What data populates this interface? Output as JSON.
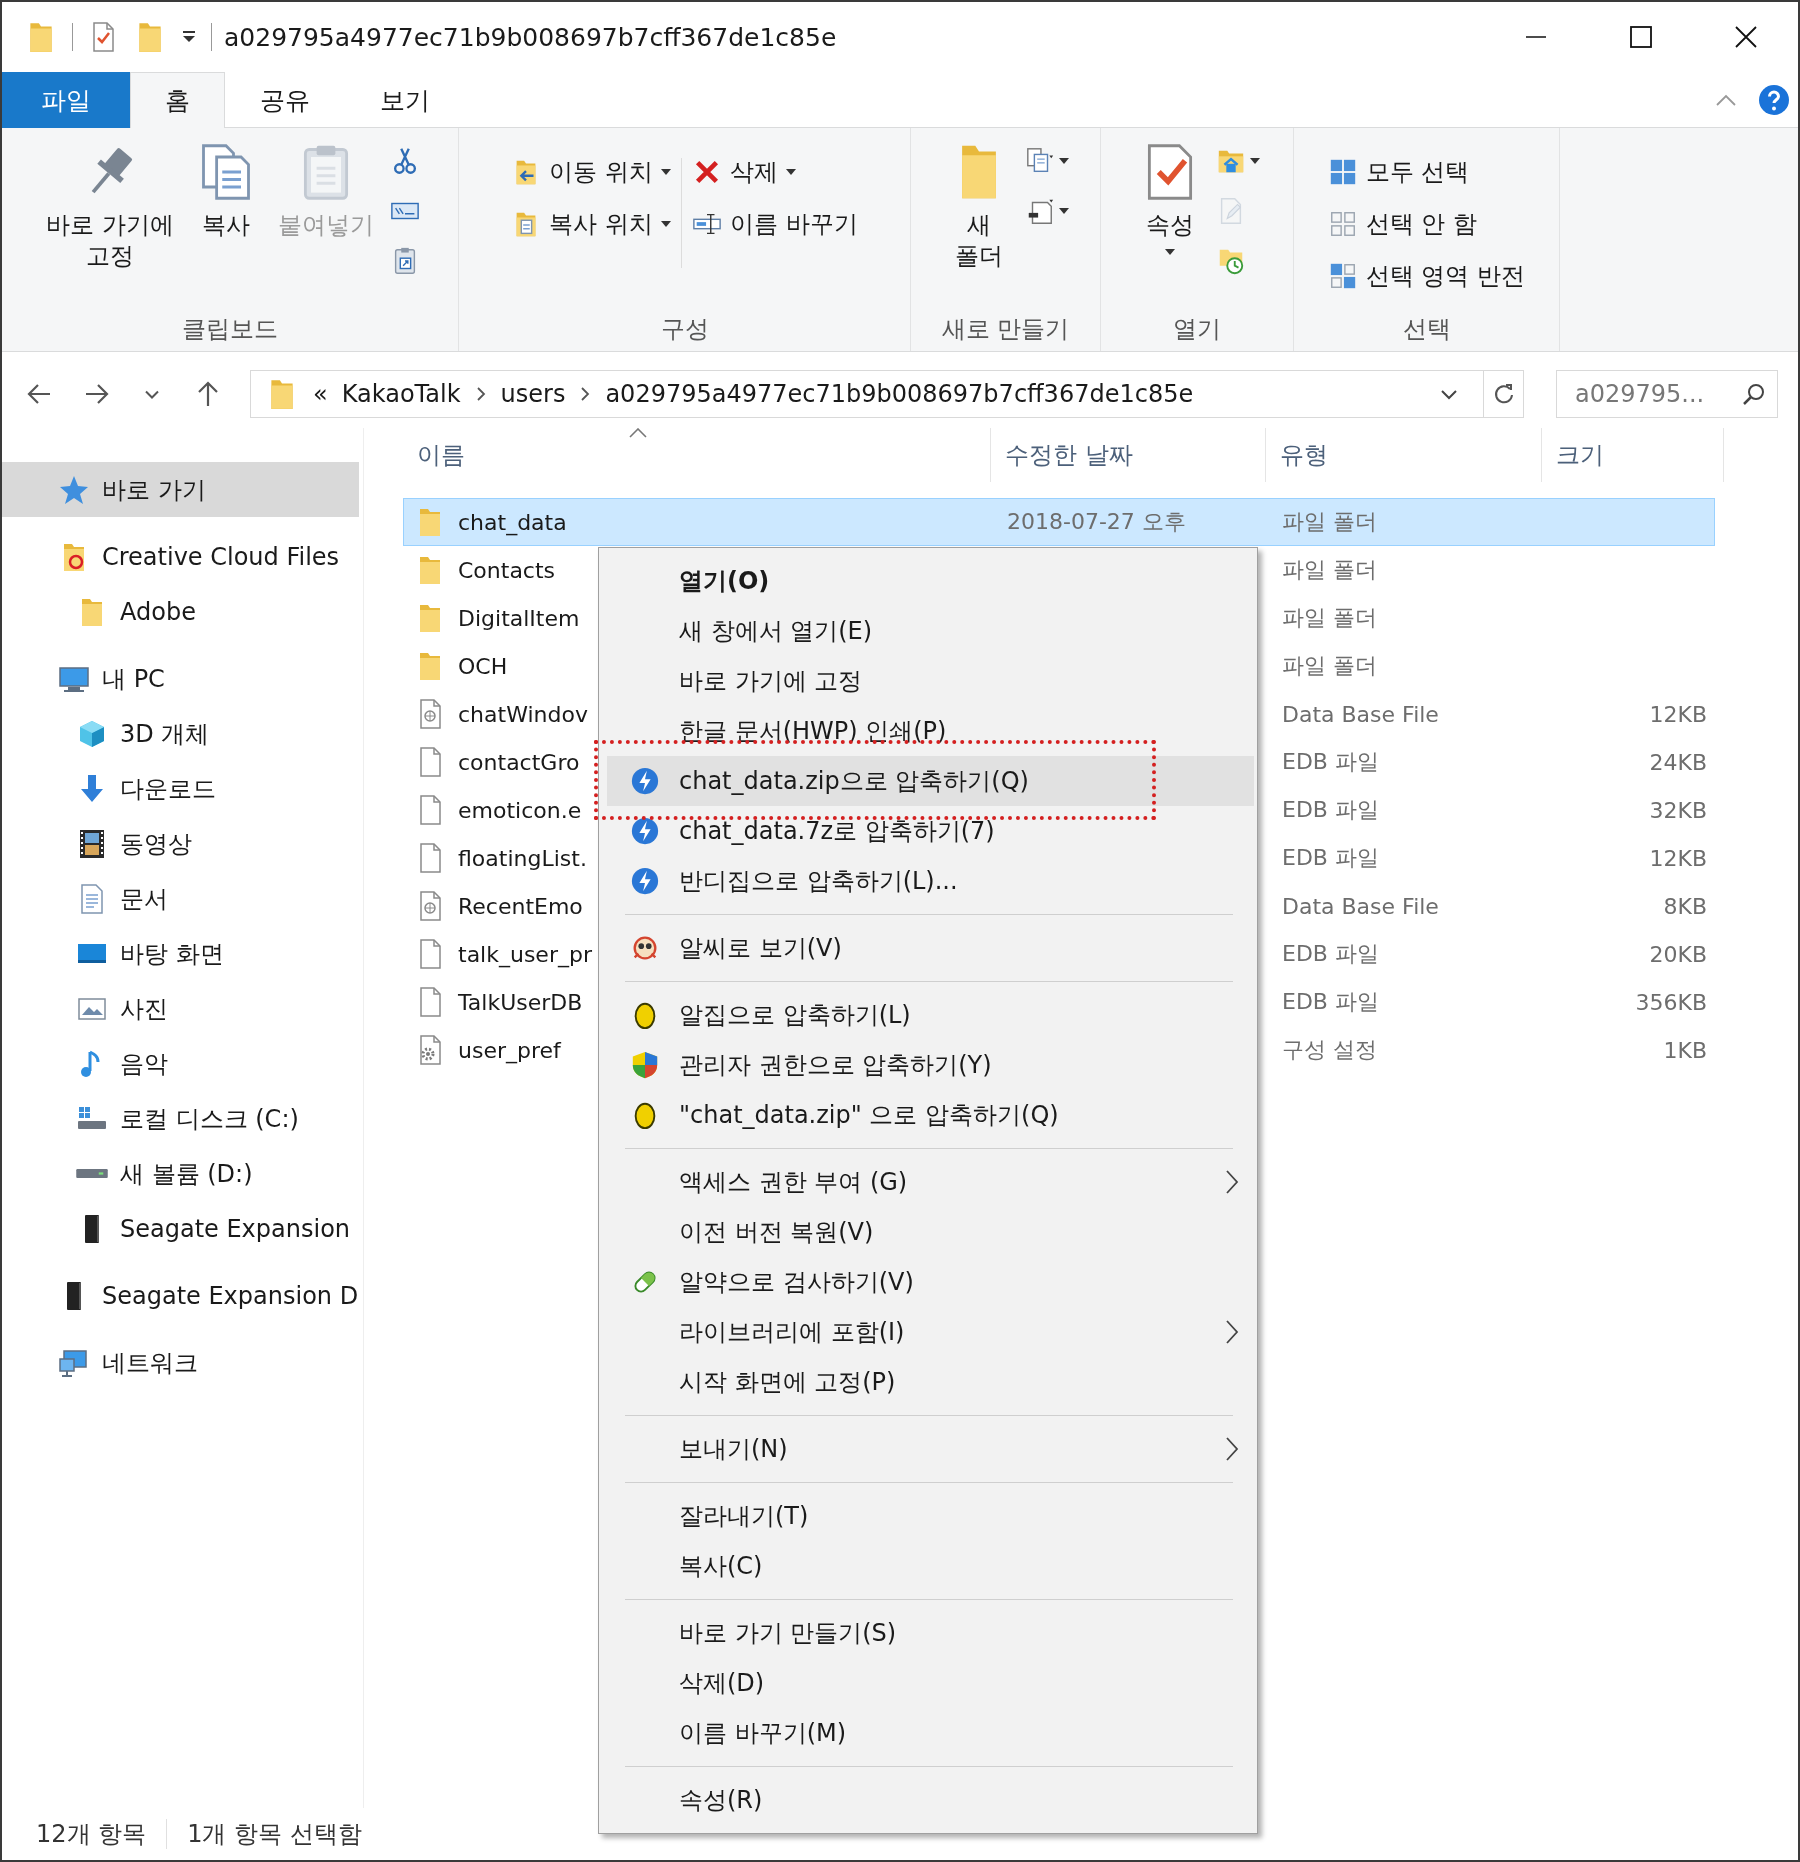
{
  "window": {
    "title": "a029795a4977ec71b9b008697b7cff367de1c85e"
  },
  "ribbon_tabs": [
    {
      "label": "파일",
      "kind": "file",
      "selected": false
    },
    {
      "label": "홈",
      "kind": "tab",
      "selected": true
    },
    {
      "label": "공유",
      "kind": "tab",
      "selected": false
    },
    {
      "label": "보기",
      "kind": "tab",
      "selected": false
    }
  ],
  "ribbon_groups": [
    {
      "label": "클립보드",
      "commands": [
        {
          "kind": "large",
          "label": "바로 가기에\n고정",
          "disabled": false,
          "dropdown": false
        },
        {
          "kind": "large",
          "label": "복사",
          "disabled": false,
          "dropdown": false
        },
        {
          "kind": "large",
          "label": "붙여넣기",
          "disabled": true,
          "dropdown": false
        },
        {
          "kind": "stack",
          "items": [
            {
              "disabled": false,
              "dropdown": false
            },
            {
              "disabled": false,
              "dropdown": false
            },
            {
              "disabled": false,
              "dropdown": false
            }
          ]
        }
      ]
    },
    {
      "label": "구성",
      "commands": [
        {
          "kind": "column",
          "items": [
            {
              "label": "이동 위치",
              "disabled": false,
              "dropdown": true
            },
            {
              "label": "복사 위치",
              "disabled": false,
              "dropdown": true
            }
          ]
        },
        {
          "kind": "column",
          "items": [
            {
              "label": "삭제",
              "disabled": false,
              "dropdown": true
            },
            {
              "label": "이름 바꾸기",
              "disabled": false,
              "dropdown": false
            }
          ]
        }
      ]
    },
    {
      "label": "새로 만들기",
      "commands": [
        {
          "kind": "large",
          "label": "새\n폴더",
          "disabled": false,
          "dropdown": false
        },
        {
          "kind": "stack",
          "items": [
            {
              "disabled": false,
              "dropdown": true
            },
            {
              "disabled": false,
              "dropdown": true
            }
          ]
        }
      ]
    },
    {
      "label": "열기",
      "commands": [
        {
          "kind": "large",
          "label": "속성",
          "disabled": false,
          "dropdown": true
        },
        {
          "kind": "stack",
          "items": [
            {
              "disabled": false,
              "dropdown": true
            },
            {
              "disabled": true,
              "dropdown": false
            },
            {
              "disabled": false,
              "dropdown": false
            }
          ]
        }
      ]
    },
    {
      "label": "선택",
      "commands": [
        {
          "kind": "column",
          "items": [
            {
              "label": "모두 선택",
              "disabled": false,
              "dropdown": false
            },
            {
              "label": "선택 안 함",
              "disabled": false,
              "dropdown": false
            },
            {
              "label": "선택 영역 반전",
              "disabled": false,
              "dropdown": false
            }
          ]
        }
      ]
    }
  ],
  "address_bar": {
    "overflow": "«",
    "breadcrumbs": [
      "KakaoTalk",
      "users",
      "a029795a4977ec71b9b008697b7cff367de1c85e"
    ]
  },
  "search": {
    "placeholder": "a029795..."
  },
  "sidebar": {
    "items": [
      {
        "label": "바로 가기",
        "selected": true
      },
      {
        "label": "Creative Cloud Files",
        "selected": false,
        "children": [
          {
            "label": "Adobe",
            "selected": false
          }
        ]
      },
      {
        "label": "내 PC",
        "selected": false,
        "children": [
          {
            "label": "3D 개체",
            "selected": false
          },
          {
            "label": "다운로드",
            "selected": false
          },
          {
            "label": "동영상",
            "selected": false
          },
          {
            "label": "문서",
            "selected": false
          },
          {
            "label": "바탕 화면",
            "selected": false
          },
          {
            "label": "사진",
            "selected": false
          },
          {
            "label": "음악",
            "selected": false
          },
          {
            "label": "로컬 디스크 (C:)",
            "selected": false
          },
          {
            "label": "새 볼륨 (D:)",
            "selected": false
          },
          {
            "label": "Seagate Expansion",
            "selected": false
          }
        ]
      },
      {
        "label": "Seagate Expansion D",
        "selected": false
      },
      {
        "label": "네트워크",
        "selected": false
      }
    ]
  },
  "table": {
    "columns": [
      "이름",
      "수정한 날짜",
      "유형",
      "크기"
    ],
    "rows": [
      {
        "kind": "folder",
        "name": "chat_data",
        "date": "2018-07-27 오후",
        "type": "파일 폴더",
        "size": "",
        "selected": true
      },
      {
        "kind": "folder",
        "name": "Contacts",
        "type": "파일 폴더",
        "size": "",
        "selected": false
      },
      {
        "kind": "folder",
        "name": "DigitalItem",
        "type": "파일 폴더",
        "size": "",
        "selected": false
      },
      {
        "kind": "folder",
        "name": "OCH",
        "type": "파일 폴더",
        "size": "",
        "selected": false
      },
      {
        "kind": "database",
        "name": "chatWindov",
        "type": "Data Base File",
        "size": "12KB",
        "selected": false
      },
      {
        "kind": "file",
        "name": "contactGro",
        "type": "EDB 파일",
        "size": "24KB",
        "selected": false
      },
      {
        "kind": "file",
        "name": "emoticon.e",
        "type": "EDB 파일",
        "size": "32KB",
        "selected": false
      },
      {
        "kind": "file",
        "name": "floatingList.",
        "type": "EDB 파일",
        "size": "12KB",
        "selected": false
      },
      {
        "kind": "database",
        "name": "RecentEmo",
        "type": "Data Base File",
        "size": "8KB",
        "selected": false
      },
      {
        "kind": "file",
        "name": "talk_user_pr",
        "type": "EDB 파일",
        "size": "20KB",
        "selected": false
      },
      {
        "kind": "file",
        "name": "TalkUserDB",
        "type": "EDB 파일",
        "size": "356KB",
        "selected": false
      },
      {
        "kind": "settings",
        "name": "user_pref",
        "type": "구성 설정",
        "size": "1KB",
        "selected": false
      }
    ]
  },
  "context_menu": {
    "items": [
      {
        "kind": "item",
        "label": "열기(O)",
        "default": true,
        "submenu": false,
        "hovered": false,
        "annotated": false
      },
      {
        "kind": "item",
        "label": "새 창에서 열기(E)",
        "default": false,
        "submenu": false,
        "hovered": false,
        "annotated": false
      },
      {
        "kind": "item",
        "label": "바로 가기에 고정",
        "default": false,
        "submenu": false,
        "hovered": false,
        "annotated": false
      },
      {
        "kind": "item",
        "label": "한글 문서(HWP) 인쇄(P)",
        "default": false,
        "submenu": false,
        "hovered": false,
        "annotated": false
      },
      {
        "kind": "item",
        "label": "chat_data.zip으로 압축하기(Q)",
        "default": false,
        "submenu": false,
        "hovered": true,
        "annotated": true
      },
      {
        "kind": "item",
        "label": "chat_data.7z로 압축하기(7)",
        "default": false,
        "submenu": false,
        "hovered": false,
        "annotated": false
      },
      {
        "kind": "item",
        "label": "반디집으로 압축하기(L)...",
        "default": false,
        "submenu": false,
        "hovered": false,
        "annotated": false
      },
      {
        "kind": "separator"
      },
      {
        "kind": "item",
        "label": "알씨로 보기(V)",
        "default": false,
        "submenu": false,
        "hovered": false,
        "annotated": false
      },
      {
        "kind": "separator"
      },
      {
        "kind": "item",
        "label": "알집으로 압축하기(L)",
        "default": false,
        "submenu": false,
        "hovered": false,
        "annotated": false
      },
      {
        "kind": "item",
        "label": "관리자 권한으로 압축하기(Y)",
        "default": false,
        "submenu": false,
        "hovered": false,
        "annotated": false
      },
      {
        "kind": "item",
        "label": "\"chat_data.zip\" 으로 압축하기(Q)",
        "default": false,
        "submenu": false,
        "hovered": false,
        "annotated": false
      },
      {
        "kind": "separator"
      },
      {
        "kind": "item",
        "label": "액세스 권한 부여 (G)",
        "default": false,
        "submenu": true,
        "hovered": false,
        "annotated": false
      },
      {
        "kind": "item",
        "label": "이전 버전 복원(V)",
        "default": false,
        "submenu": false,
        "hovered": false,
        "annotated": false
      },
      {
        "kind": "item",
        "label": "알약으로 검사하기(V)",
        "default": false,
        "submenu": false,
        "hovered": false,
        "annotated": false
      },
      {
        "kind": "item",
        "label": "라이브러리에 포함(I)",
        "default": false,
        "submenu": true,
        "hovered": false,
        "annotated": false
      },
      {
        "kind": "item",
        "label": "시작 화면에 고정(P)",
        "default": false,
        "submenu": false,
        "hovered": false,
        "annotated": false
      },
      {
        "kind": "separator"
      },
      {
        "kind": "item",
        "label": "보내기(N)",
        "default": false,
        "submenu": true,
        "hovered": false,
        "annotated": false
      },
      {
        "kind": "separator"
      },
      {
        "kind": "item",
        "label": "잘라내기(T)",
        "default": false,
        "submenu": false,
        "hovered": false,
        "annotated": false
      },
      {
        "kind": "item",
        "label": "복사(C)",
        "default": false,
        "submenu": false,
        "hovered": false,
        "annotated": false
      },
      {
        "kind": "separator"
      },
      {
        "kind": "item",
        "label": "바로 가기 만들기(S)",
        "default": false,
        "submenu": false,
        "hovered": false,
        "annotated": false
      },
      {
        "kind": "item",
        "label": "삭제(D)",
        "default": false,
        "submenu": false,
        "hovered": false,
        "annotated": false
      },
      {
        "kind": "item",
        "label": "이름 바꾸기(M)",
        "default": false,
        "submenu": false,
        "hovered": false,
        "annotated": false
      },
      {
        "kind": "separator"
      },
      {
        "kind": "item",
        "label": "속성(R)",
        "default": false,
        "submenu": false,
        "hovered": false,
        "annotated": false
      }
    ]
  },
  "status_bar": {
    "items": [
      "12개 항목",
      "1개 항목 선택함"
    ]
  }
}
